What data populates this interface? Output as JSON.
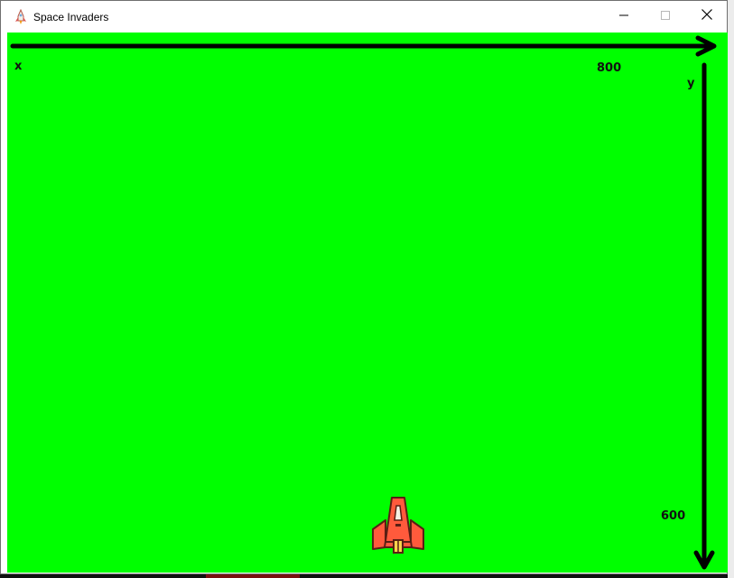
{
  "window": {
    "title": "Space Invaders",
    "app_icon": "rocket-icon",
    "controls": {
      "minimize": "minimize-icon",
      "maximize": "maximize-icon",
      "close": "close-icon"
    }
  },
  "game": {
    "background_color": "#00ff00",
    "axis_labels": {
      "x": "x",
      "y": "y",
      "width": "800",
      "height": "600"
    },
    "player": {
      "sprite": "spaceship-icon",
      "color": "#ff5a3c"
    }
  }
}
